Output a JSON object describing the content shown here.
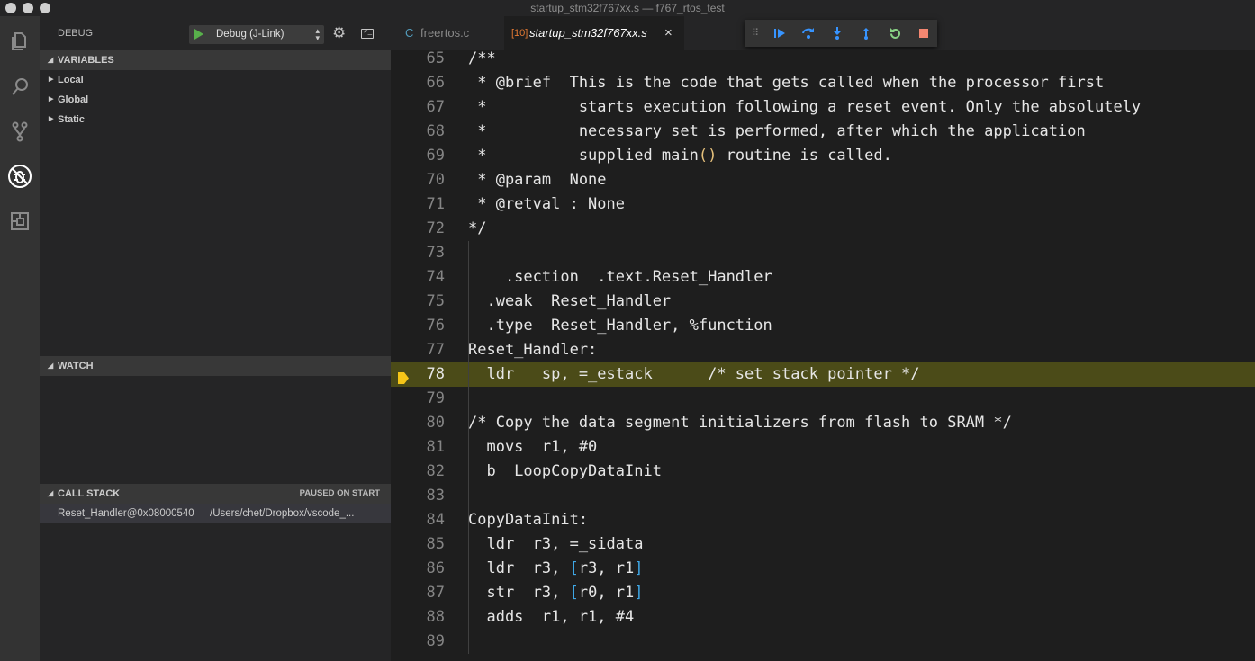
{
  "window": {
    "title": "startup_stm32f767xx.s — f767_rtos_test"
  },
  "activity_bar": [
    "explorer-icon",
    "search-icon",
    "source-control-icon",
    "debug-icon",
    "extensions-icon"
  ],
  "debug_panel": {
    "title": "DEBUG",
    "configuration": "Debug (J-Link)",
    "variables": {
      "header": "VARIABLES",
      "scopes": [
        "Local",
        "Global",
        "Static"
      ]
    },
    "watch": {
      "header": "WATCH"
    },
    "call_stack": {
      "header": "CALL STACK",
      "status": "PAUSED ON START",
      "frames": [
        {
          "function": "Reset_Handler@0x08000540",
          "path": "/Users/chet/Dropbox/vscode_..."
        }
      ]
    }
  },
  "tabs": [
    {
      "label": "freertos.c",
      "icon": "C",
      "active": false
    },
    {
      "label": "startup_stm32f767xx.s",
      "icon": "[10]",
      "active": true,
      "close": "×"
    }
  ],
  "debug_toolbar": [
    "drag-handle-icon",
    "continue-icon",
    "step-over-icon",
    "step-into-icon",
    "step-out-icon",
    "restart-icon",
    "stop-icon"
  ],
  "editor": {
    "current_line": 78,
    "lines": [
      {
        "n": "65",
        "t": "/**"
      },
      {
        "n": "66",
        "t": " * @brief  This is the code that gets called when the processor first"
      },
      {
        "n": "67",
        "t": " *          starts execution following a reset event. Only the absolutely"
      },
      {
        "n": "68",
        "t": " *          necessary set is performed, after which the application"
      },
      {
        "n": "69",
        "t": " *          supplied main() routine is called."
      },
      {
        "n": "70",
        "t": " * @param  None"
      },
      {
        "n": "71",
        "t": " * @retval : None"
      },
      {
        "n": "72",
        "t": "*/"
      },
      {
        "n": "73",
        "t": ""
      },
      {
        "n": "74",
        "t": "    .section  .text.Reset_Handler"
      },
      {
        "n": "75",
        "t": "  .weak  Reset_Handler"
      },
      {
        "n": "76",
        "t": "  .type  Reset_Handler, %function"
      },
      {
        "n": "77",
        "t": "Reset_Handler:"
      },
      {
        "n": "78",
        "t": "  ldr   sp, =_estack      /* set stack pointer */"
      },
      {
        "n": "79",
        "t": ""
      },
      {
        "n": "80",
        "t": "/* Copy the data segment initializers from flash to SRAM */"
      },
      {
        "n": "81",
        "t": "  movs  r1, #0"
      },
      {
        "n": "82",
        "t": "  b  LoopCopyDataInit"
      },
      {
        "n": "83",
        "t": ""
      },
      {
        "n": "84",
        "t": "CopyDataInit:"
      },
      {
        "n": "85",
        "t": "  ldr  r3, =_sidata"
      },
      {
        "n": "86",
        "t": "  ldr  r3, [r3, r1]"
      },
      {
        "n": "87",
        "t": "  str  r3, [r0, r1]"
      },
      {
        "n": "88",
        "t": "  adds  r1, r1, #4"
      },
      {
        "n": "89",
        "t": ""
      }
    ]
  },
  "colors": {
    "current_line_bg": "#4b4b18",
    "breakpoint_arrow": "#f5c518",
    "continue": "#3794ff",
    "restart": "#89d185",
    "stop": "#f48771"
  }
}
